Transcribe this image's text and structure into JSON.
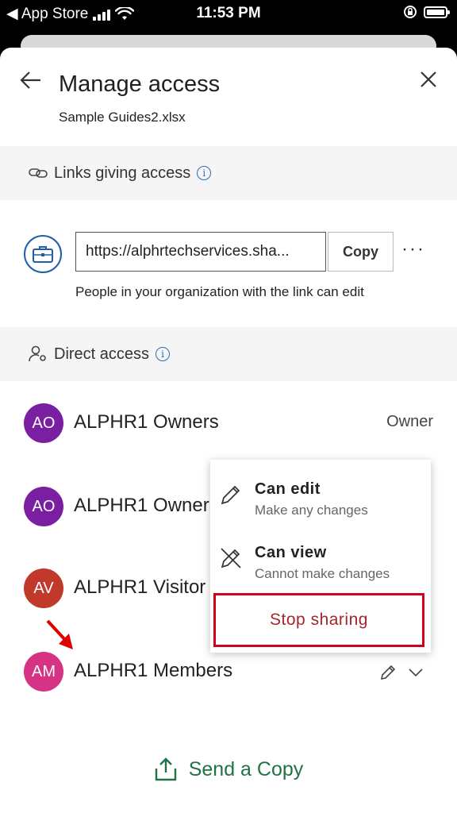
{
  "status_bar": {
    "back_label": "◀ App Store",
    "time": "11:53 PM"
  },
  "header": {
    "title": "Manage access",
    "file_name": "Sample Guides2.xlsx"
  },
  "links_section": {
    "heading": "Links giving access",
    "url": "https://alphrtechservices.sha...",
    "copy_label": "Copy",
    "more_label": "···",
    "description": "People in your organization with the link can edit"
  },
  "direct_access": {
    "heading": "Direct access",
    "people": [
      {
        "initials": "AO",
        "name": "ALPHR1 Owners",
        "role": "Owner",
        "color": "#7b1fa2"
      },
      {
        "initials": "AO",
        "name": "ALPHR1 Owner",
        "role": "",
        "color": "#7b1fa2"
      },
      {
        "initials": "AV",
        "name": "ALPHR1 Visitor",
        "role": "",
        "color": "#c0392b"
      },
      {
        "initials": "AM",
        "name": "ALPHR1 Members",
        "role": "",
        "color": "#d63384"
      }
    ]
  },
  "permission_menu": {
    "can_edit": {
      "title": "Can edit",
      "subtitle": "Make any changes"
    },
    "can_view": {
      "title": "Can view",
      "subtitle": "Cannot make changes"
    },
    "stop_sharing": "Stop sharing"
  },
  "footer": {
    "send_copy": "Send a Copy"
  },
  "colors": {
    "accent_blue": "#1f5fa8",
    "excel_green": "#217346",
    "danger_red": "#d0021b"
  }
}
